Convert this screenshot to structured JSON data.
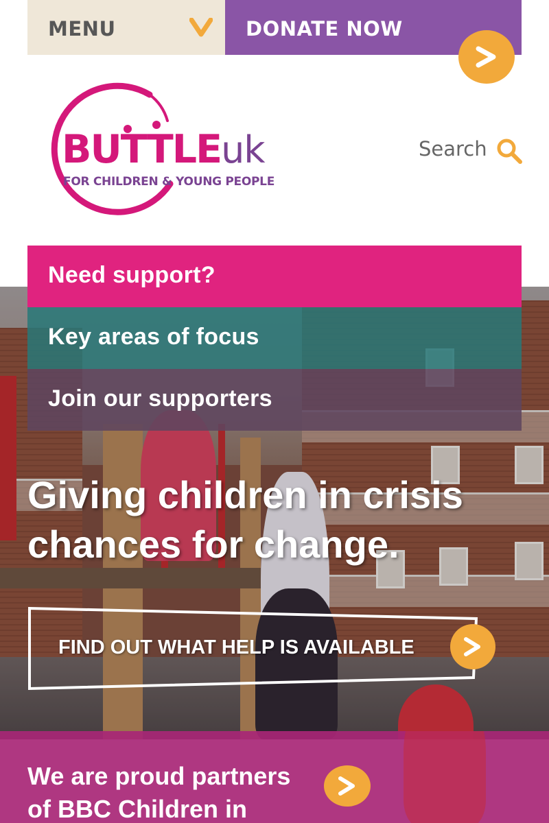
{
  "header": {
    "menu_label": "MENU",
    "donate_label": "DONATE NOW"
  },
  "logo": {
    "name": "BUTTLE",
    "suffix": "uk",
    "tagline": "FOR CHILDREN & YOUNG PEOPLE"
  },
  "search": {
    "label": "Search"
  },
  "nav": {
    "items": [
      {
        "label": "Need support?",
        "color": "#e0237f"
      },
      {
        "label": "Key areas of focus",
        "color": "#287878"
      },
      {
        "label": "Join our supporters",
        "color": "#5f465f"
      }
    ]
  },
  "hero": {
    "headline": "Giving children in crisis chances for change.",
    "cta_label": "FIND OUT WHAT HELP IS AVAILABLE"
  },
  "partner": {
    "text": "We are proud partners of BBC Children in"
  },
  "colors": {
    "accent_orange": "#f2a93b",
    "donate_purple": "#8a55a6",
    "brand_pink": "#d4187a",
    "menu_beige": "#efe7d8"
  }
}
